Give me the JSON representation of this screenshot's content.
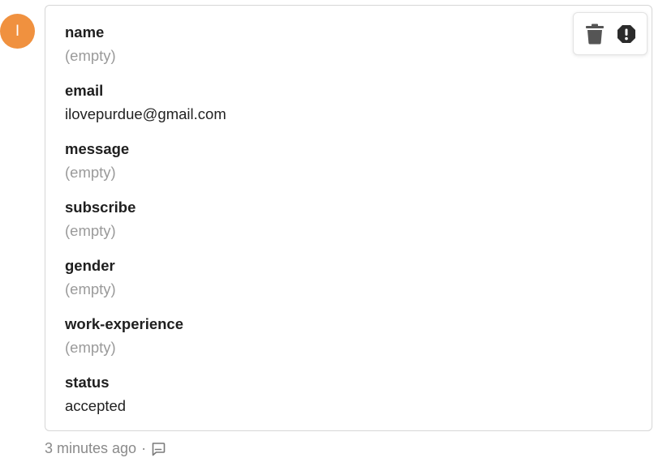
{
  "avatar": {
    "initial": "I",
    "color": "#f0913f"
  },
  "fields": [
    {
      "label": "name",
      "value": "(empty)",
      "empty": true
    },
    {
      "label": "email",
      "value": "ilovepurdue@gmail.com",
      "empty": false
    },
    {
      "label": "message",
      "value": "(empty)",
      "empty": true
    },
    {
      "label": "subscribe",
      "value": "(empty)",
      "empty": true
    },
    {
      "label": "gender",
      "value": "(empty)",
      "empty": true
    },
    {
      "label": "work-experience",
      "value": "(empty)",
      "empty": true
    },
    {
      "label": "status",
      "value": "accepted",
      "empty": false
    }
  ],
  "actions": {
    "delete_icon": "trash-icon",
    "spam_icon": "exclamation-icon"
  },
  "footer": {
    "timestamp": "3 minutes ago",
    "separator": "·",
    "comment_icon": "comment-icon"
  }
}
